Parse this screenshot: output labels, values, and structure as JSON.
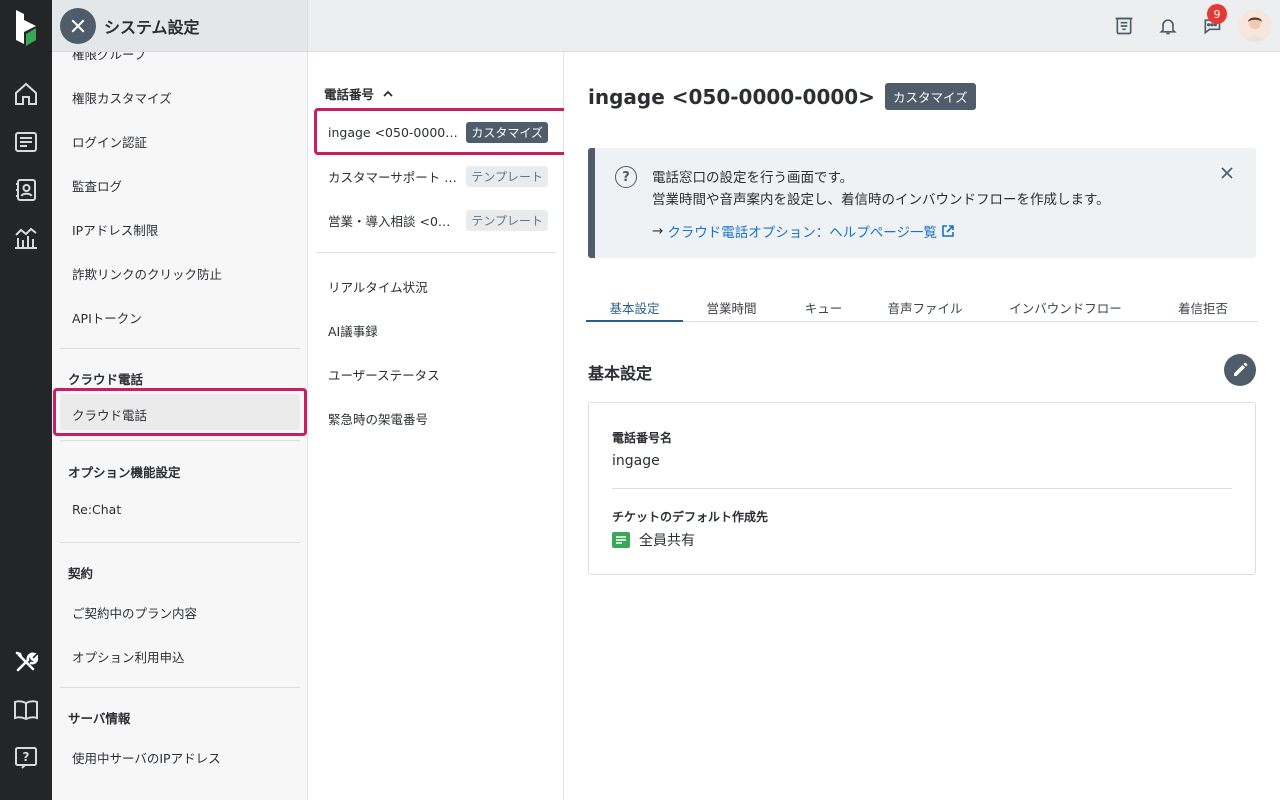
{
  "header": {
    "title": "システム設定",
    "notification_count": "9"
  },
  "rail": {
    "icons": [
      "logo-icon",
      "home-icon",
      "ticket-icon",
      "contacts-icon",
      "report-icon",
      "tools-icon",
      "book-icon",
      "help-icon"
    ]
  },
  "menu": {
    "top_items": [
      "権限グループ",
      "権限カスタマイズ",
      "ログイン認証",
      "監査ログ",
      "IPアドレス制限",
      "詐欺リンクのクリック防止",
      "APIトークン"
    ],
    "sections": {
      "cloud_phone": {
        "title": "クラウド電話",
        "items": [
          "クラウド電話"
        ]
      },
      "options": {
        "title": "オプション機能設定",
        "items": [
          "Re:Chat"
        ]
      },
      "contract": {
        "title": "契約",
        "items": [
          "ご契約中のプラン内容",
          "オプション利用申込"
        ]
      },
      "server": {
        "title": "サーバ情報",
        "items": [
          "使用中サーバのIPアドレス"
        ]
      }
    }
  },
  "phone_list": {
    "header": "電話番号",
    "numbers": [
      {
        "name": "ingage <050-0000-00…",
        "tag": "カスタマイズ"
      },
      {
        "name": "カスタマーサポート <…",
        "tag": "テンプレート"
      },
      {
        "name": "営業・導入相談 <050-…",
        "tag": "テンプレート"
      }
    ],
    "links": [
      "リアルタイム状況",
      "AI議事録",
      "ユーザーステータス",
      "緊急時の架電番号"
    ]
  },
  "main": {
    "title": "ingage <050-0000-0000>",
    "title_tag": "カスタマイズ",
    "info": {
      "line1": "電話窓口の設定を行う画面です。",
      "line2": "営業時間や音声案内を設定し、着信時のインバウンドフローを作成します。",
      "arrow": "→",
      "link": "クラウド電話オプション：ヘルプページ一覧"
    },
    "tabs": [
      "基本設定",
      "営業時間",
      "キュー",
      "音声ファイル",
      "インバウンドフロー",
      "着信拒否"
    ],
    "section_title": "基本設定",
    "fields": {
      "name_label": "電話番号名",
      "name_value": "ingage",
      "dest_label": "チケットのデフォルト作成先",
      "dest_value": "全員共有"
    }
  },
  "colors": {
    "rail_bg": "#232527",
    "accent_dark": "#4e5d69",
    "highlight": "#c81e62",
    "link": "#1a73c4",
    "logo_green": "#3aa657"
  }
}
